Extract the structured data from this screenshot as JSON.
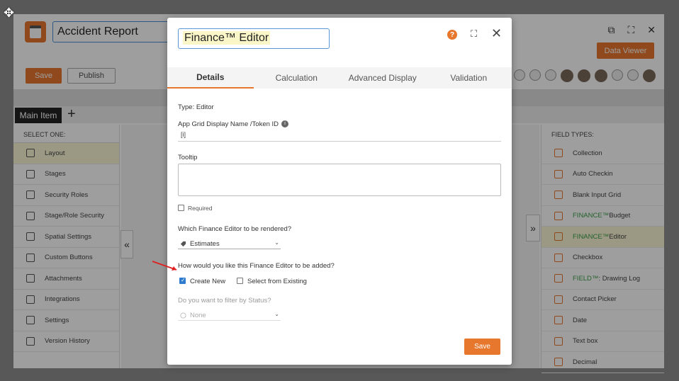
{
  "background_app": {
    "title": "Accident Report",
    "data_viewer_label": "Data Viewer",
    "save_label": "Save",
    "publish_label": "Publish",
    "main_tab_label": "Main Item",
    "select_one_label": "SELECT ONE:",
    "field_types_label": "FIELD TYPES:",
    "left_items": [
      "Layout",
      "Stages",
      "Security Roles",
      "Stage/Role Security",
      "Spatial Settings",
      "Custom Buttons",
      "Attachments",
      "Integrations",
      "Settings",
      "Version History"
    ],
    "right_items": [
      {
        "prefix": "",
        "label": "Collection"
      },
      {
        "prefix": "",
        "label": "Auto Checkin"
      },
      {
        "prefix": "",
        "label": "Blank Input Grid"
      },
      {
        "prefix": "FINANCE™",
        "label": " Budget"
      },
      {
        "prefix": "FINANCE™",
        "label": " Editor"
      },
      {
        "prefix": "",
        "label": "Checkbox"
      },
      {
        "prefix": "FIELD™",
        "label": ": Drawing Log"
      },
      {
        "prefix": "",
        "label": "Contact Picker"
      },
      {
        "prefix": "",
        "label": "Date"
      },
      {
        "prefix": "",
        "label": "Text box"
      },
      {
        "prefix": "",
        "label": "Decimal"
      }
    ]
  },
  "modal": {
    "title": "Finance™ Editor",
    "tabs": [
      "Details",
      "Calculation",
      "Advanced Display",
      "Validation"
    ],
    "type_label": "Type: Editor",
    "grid_name_label": "App Grid Display Name /Token ID",
    "token_value": "[i]",
    "tooltip_label": "Tooltip",
    "required_label": "Required",
    "which_editor_label": "Which Finance Editor to be rendered?",
    "which_editor_value": "Estimates",
    "how_added_label": "How would you like this Finance Editor to be added?",
    "create_new_label": "Create New",
    "select_existing_label": "Select from Existing",
    "filter_label": "Do you want to filter by Status?",
    "filter_value": "None",
    "save_label": "Save"
  },
  "colors": {
    "accent": "#e8772e",
    "link_blue": "#2e7bcf",
    "highlight": "#fbf6d6"
  }
}
